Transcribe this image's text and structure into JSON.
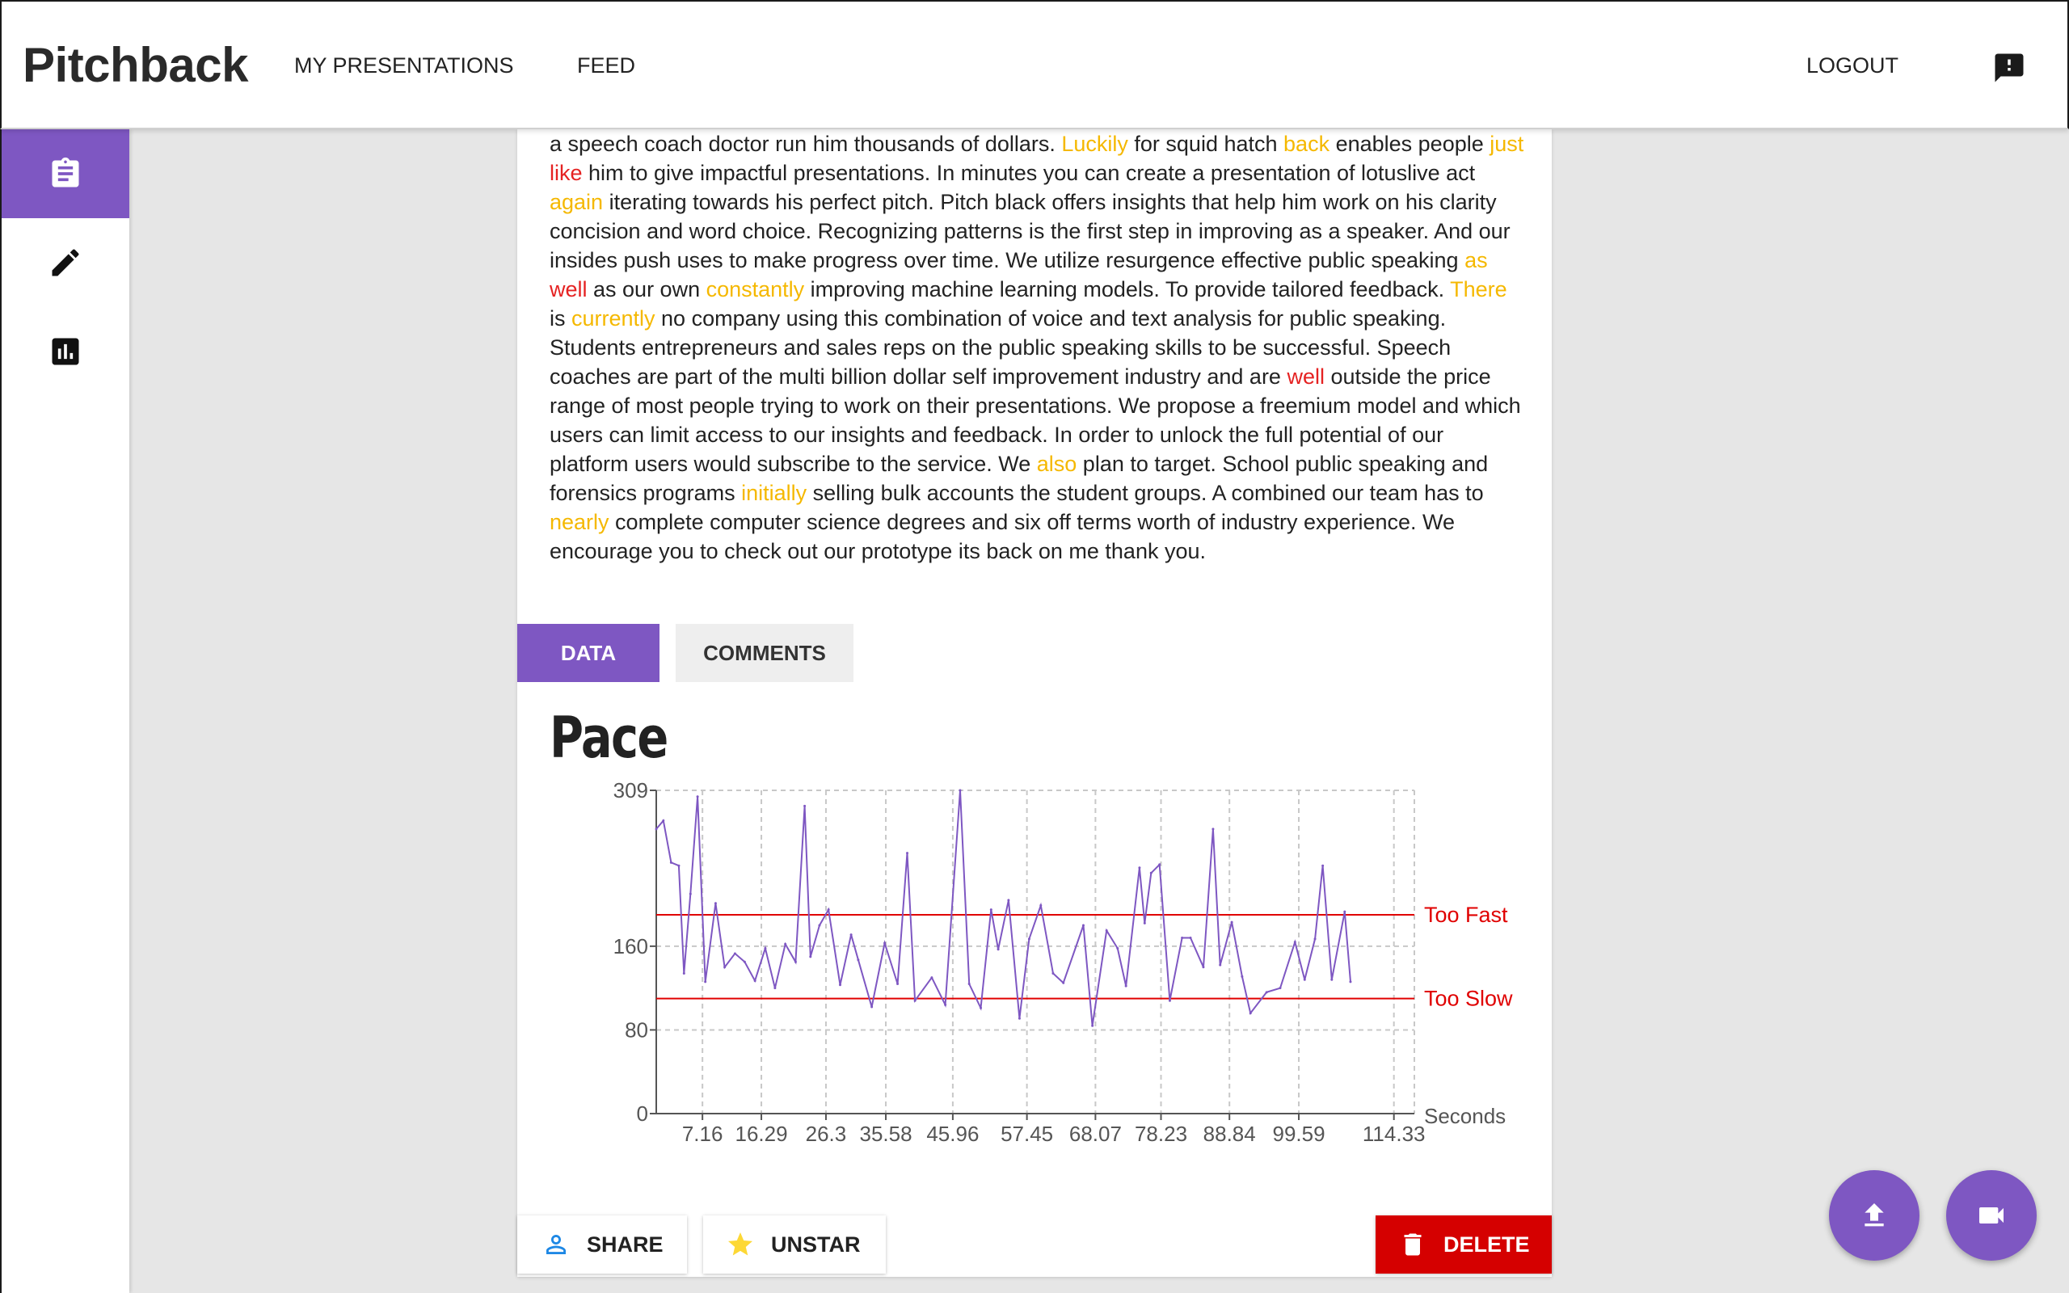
{
  "app": {
    "brand": "Pitchback"
  },
  "nav": {
    "my_presentations": "MY PRESENTATIONS",
    "feed": "FEED",
    "logout": "LOGOUT"
  },
  "icons": {
    "feedback": "feedback-icon",
    "sidebar": [
      "clipboard-icon",
      "pencil-icon",
      "bar-chart-icon"
    ],
    "share": "person-icon",
    "unstar": "star-icon",
    "delete": "trash-icon",
    "upload": "upload-icon",
    "video": "video-camera-icon"
  },
  "colors": {
    "accent": "#7e57c2",
    "danger": "#d50000",
    "filler_word": "#f5b800",
    "weak_phrase": "#e52222",
    "threshold_line": "#e00000"
  },
  "transcript": [
    {
      "t": "a speech coach doctor run him thousands of dollars. "
    },
    {
      "t": "Luckily",
      "c": "y"
    },
    {
      "t": " for squid hatch "
    },
    {
      "t": "back",
      "c": "y"
    },
    {
      "t": " enables people "
    },
    {
      "t": "just",
      "c": "y"
    },
    {
      "t": " "
    },
    {
      "t": "like",
      "c": "r"
    },
    {
      "t": " him to give impactful presentations. In minutes you can create a presentation of lotuslive act "
    },
    {
      "t": "again",
      "c": "y"
    },
    {
      "t": " iterating towards his perfect pitch. Pitch black offers insights that help him work on his clarity concision and word choice. Recognizing patterns is the first step in improving as a speaker. And our insides push uses to make progress over time. We utilize resurgence effective public speaking "
    },
    {
      "t": "as",
      "c": "y"
    },
    {
      "t": " "
    },
    {
      "t": "well",
      "c": "r"
    },
    {
      "t": " as our own "
    },
    {
      "t": "constantly",
      "c": "y"
    },
    {
      "t": " improving machine learning models. To provide tailored feedback. "
    },
    {
      "t": "There",
      "c": "y"
    },
    {
      "t": " is "
    },
    {
      "t": "currently",
      "c": "y"
    },
    {
      "t": " no company using this combination of voice and text analysis for public speaking. Students entrepreneurs and sales reps on the public speaking skills to be successful. Speech coaches are part of the multi billion dollar self improvement industry and are "
    },
    {
      "t": "well",
      "c": "r"
    },
    {
      "t": " outside the price range of most people trying to work on their presentations. We propose a freemium model and which users can limit access to our insights and feedback. In order to unlock the full potential of our platform users would subscribe to the service. We "
    },
    {
      "t": "also",
      "c": "y"
    },
    {
      "t": " plan to target. School public speaking and forensics programs "
    },
    {
      "t": "initially",
      "c": "y"
    },
    {
      "t": " selling bulk accounts the student groups. A combined our team has to "
    },
    {
      "t": "nearly",
      "c": "y"
    },
    {
      "t": " complete computer science degrees and six off terms worth of industry experience. We encourage you to check out our prototype its back on me thank you."
    }
  ],
  "tabs": {
    "data": "DATA",
    "comments": "COMMENTS"
  },
  "chart_title": "Pace",
  "chart_data": {
    "type": "line",
    "title": "Pace",
    "xlabel": "Seconds",
    "ylabel": "",
    "xlim": [
      0,
      117.5
    ],
    "ylim": [
      0,
      309
    ],
    "grid": true,
    "xticks": [
      "7.16",
      "16.29",
      "26.3",
      "35.58",
      "45.96",
      "57.45",
      "68.07",
      "78.23",
      "88.84",
      "99.59",
      "114.33"
    ],
    "yticks": [
      "0",
      "80",
      "160",
      "309"
    ],
    "xtick_values": [
      7.16,
      16.29,
      26.3,
      35.58,
      45.96,
      57.45,
      68.07,
      78.23,
      88.84,
      99.59,
      114.33
    ],
    "ytick_values": [
      0,
      80,
      160,
      309
    ],
    "thresholds": [
      {
        "label": "Too Fast",
        "value": 190
      },
      {
        "label": "Too Slow",
        "value": 110
      }
    ],
    "series": [
      {
        "values": [
          [
            0.0,
            272
          ],
          [
            1.1,
            280
          ],
          [
            2.3,
            240
          ],
          [
            3.5,
            237
          ],
          [
            4.3,
            134
          ],
          [
            5.3,
            210
          ],
          [
            6.4,
            303
          ],
          [
            7.6,
            126
          ],
          [
            9.2,
            201
          ],
          [
            10.6,
            140
          ],
          [
            12.2,
            153
          ],
          [
            13.7,
            145
          ],
          [
            15.3,
            127
          ],
          [
            16.9,
            158
          ],
          [
            18.4,
            120
          ],
          [
            20.0,
            162
          ],
          [
            21.6,
            145
          ],
          [
            23.0,
            294
          ],
          [
            23.9,
            150
          ],
          [
            25.3,
            180
          ],
          [
            26.7,
            195
          ],
          [
            28.5,
            123
          ],
          [
            30.2,
            171
          ],
          [
            31.3,
            147
          ],
          [
            33.4,
            102
          ],
          [
            35.4,
            163
          ],
          [
            37.4,
            124
          ],
          [
            38.9,
            249
          ],
          [
            40.1,
            108
          ],
          [
            42.7,
            130
          ],
          [
            44.8,
            104
          ],
          [
            47.1,
            309
          ],
          [
            48.5,
            124
          ],
          [
            50.3,
            101
          ],
          [
            51.9,
            195
          ],
          [
            53.0,
            157
          ],
          [
            54.6,
            204
          ],
          [
            56.3,
            91
          ],
          [
            57.8,
            167
          ],
          [
            59.6,
            199
          ],
          [
            61.5,
            134
          ],
          [
            63.1,
            125
          ],
          [
            66.2,
            180
          ],
          [
            67.6,
            84
          ],
          [
            69.8,
            175
          ],
          [
            71.5,
            158
          ],
          [
            72.8,
            122
          ],
          [
            74.9,
            235
          ],
          [
            75.7,
            182
          ],
          [
            76.7,
            230
          ],
          [
            78.0,
            238
          ],
          [
            79.6,
            108
          ],
          [
            81.5,
            168
          ],
          [
            82.8,
            168
          ],
          [
            84.8,
            140
          ],
          [
            86.3,
            272
          ],
          [
            87.4,
            142
          ],
          [
            89.2,
            183
          ],
          [
            90.8,
            131
          ],
          [
            92.1,
            96
          ],
          [
            94.6,
            116
          ],
          [
            96.7,
            120
          ],
          [
            99.0,
            164
          ],
          [
            100.5,
            128
          ],
          [
            102.1,
            167
          ],
          [
            103.3,
            237
          ],
          [
            104.7,
            128
          ],
          [
            106.7,
            193
          ],
          [
            107.6,
            126
          ]
        ]
      }
    ]
  },
  "actions": {
    "share": "SHARE",
    "unstar": "UNSTAR",
    "delete": "DELETE"
  }
}
